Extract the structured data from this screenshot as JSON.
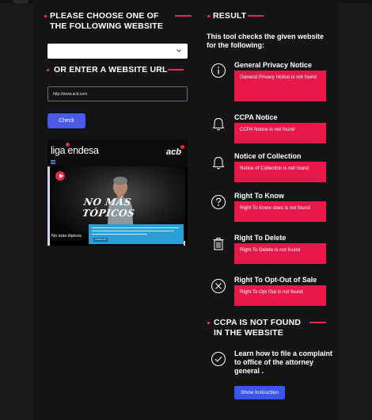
{
  "left": {
    "choose_heading_line1": "PLEASE CHOOSE ONE OF",
    "choose_heading_line2": "THE FOLLOWING WEBSITE",
    "select_value": "",
    "url_heading": "OR ENTER A WEBSITE URL",
    "url_value": "http://www.acb.com",
    "check_label": "Check"
  },
  "preview": {
    "logo_text": "liga endesa",
    "brand_right": "acb",
    "tagline": "NO MÁS TÓPICOS",
    "caption": "No más tópicos",
    "cookie_button": "ACEPTAR"
  },
  "result": {
    "heading": "RESULT",
    "intro": "This tool checks the given website for the following:",
    "items": [
      {
        "title": "General Privacy Notice",
        "status": "General Privacy Notice is not found",
        "icon": "info-icon"
      },
      {
        "title": "CCPA Notice",
        "status": "CCPA Notice is not found",
        "icon": "bell-icon"
      },
      {
        "title": "Notice of Collection",
        "status": "Notice of Collection is not found",
        "icon": "bell-icon"
      },
      {
        "title": "Right To Know",
        "status": "Right To Know does is not found",
        "icon": "question-icon"
      },
      {
        "title": "Right To Delete",
        "status": "Right To Delete is not found",
        "icon": "trash-icon"
      },
      {
        "title": "Right To Opt-Out of Sale",
        "status": "Right To Opt Out is not found",
        "icon": "x-circle-icon"
      }
    ],
    "verdict_line1": "CCPA IS NOT FOUND",
    "verdict_line2": "IN THE WEBSITE",
    "cta_text": "Learn how to file a complaint to office of the attorney general .",
    "cta_icon": "check-circle-icon",
    "show_button": "Show Instruction"
  },
  "colors": {
    "background": "#1a1a1d",
    "accent_red": "#e8294a",
    "status_box": "#e8194a",
    "button_blue": "#4a5ae8"
  }
}
